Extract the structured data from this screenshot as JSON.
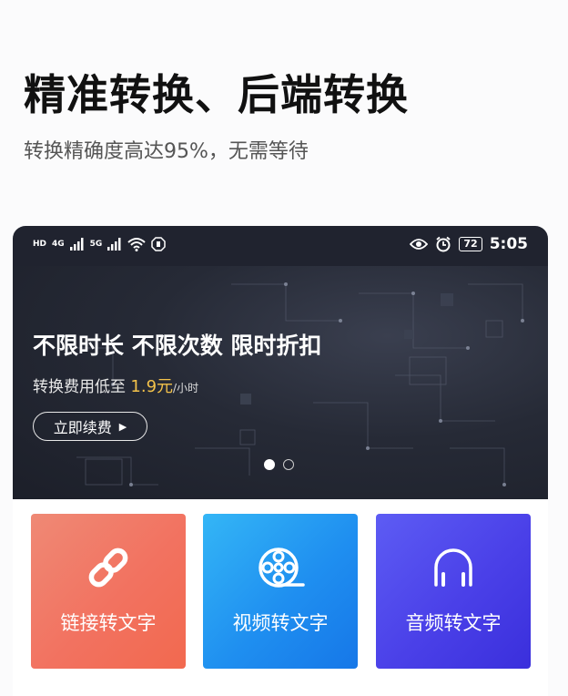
{
  "promo": {
    "headline": "精准转换、后端转换",
    "subline": "转换精确度高达95%，无需等待"
  },
  "status_bar": {
    "left_badges": [
      "HD",
      "4G",
      "5G"
    ],
    "battery": "72",
    "time": "5:05"
  },
  "banner": {
    "title": "不限时长 不限次数 限时折扣",
    "price_prefix": "转换费用低至",
    "price_value": "1.9元",
    "price_unit": "/小时",
    "button_label": "立即续费",
    "slides_total": 2,
    "slide_active": 1
  },
  "features": [
    {
      "label": "链接转文字",
      "icon": "link-icon"
    },
    {
      "label": "视频转文字",
      "icon": "film-reel-icon"
    },
    {
      "label": "音频转文字",
      "icon": "headphones-icon"
    }
  ],
  "colors": {
    "link_tile": "#f27260",
    "video_tile": "#1f8ff0",
    "audio_tile": "#4a40e8",
    "price_highlight": "#f3c24a"
  }
}
